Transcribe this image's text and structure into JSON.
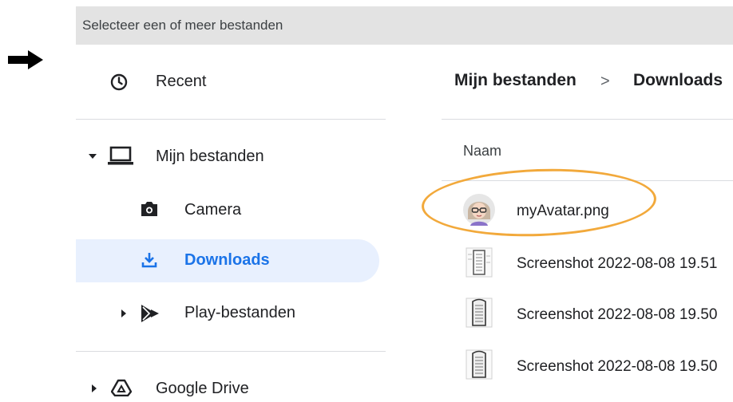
{
  "dialog": {
    "title": "Selecteer een of meer bestanden"
  },
  "sidebar": {
    "recent": "Recent",
    "my_files": "Mijn bestanden",
    "camera": "Camera",
    "downloads": "Downloads",
    "play_files": "Play-bestanden",
    "google_drive": "Google Drive"
  },
  "breadcrumb": {
    "root": "Mijn bestanden",
    "separator": ">",
    "current": "Downloads"
  },
  "file_list": {
    "column_name": "Naam",
    "files": [
      {
        "name": "myAvatar.png",
        "thumb": "avatar"
      },
      {
        "name": "Screenshot 2022-08-08 19.51",
        "thumb": "screenshot"
      },
      {
        "name": "Screenshot 2022-08-08 19.50",
        "thumb": "screenshot"
      },
      {
        "name": "Screenshot 2022-08-08 19.50",
        "thumb": "screenshot"
      }
    ]
  },
  "colors": {
    "accent": "#1a73e8",
    "selected_bg": "#e8f0fe",
    "highlight": "#f2a93b",
    "titlebar_bg": "#e3e3e3"
  }
}
